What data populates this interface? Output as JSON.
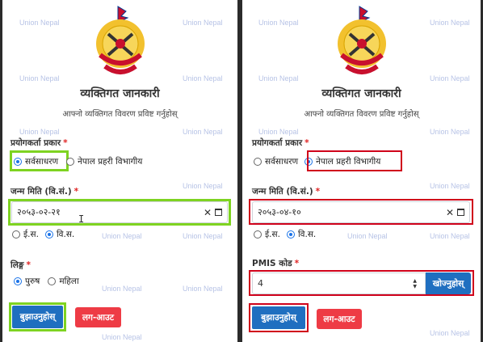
{
  "watermark": "Union Nepal",
  "left": {
    "title": "व्यक्तिगत जानकारी",
    "subtitle": "आफ्नो व्यक्तिगत विवरण प्रविष्ट गर्नुहोस्",
    "user_type_label": "प्रयोगकर्ता प्रकार",
    "user_type_options": [
      "सर्वसाधरण",
      "नेपाल प्रहरी विभागीय"
    ],
    "user_type_selected": "सर्वसाधरण",
    "dob_label": "जन्म मिति (वि.सं.)",
    "dob_value": "२०५३-०२-२१",
    "calendar_options": [
      "ई.स.",
      "वि.स."
    ],
    "calendar_selected": "वि.स.",
    "gender_label": "लिङ्ग",
    "gender_options": [
      "पुरुष",
      "महिला"
    ],
    "gender_selected": "पुरुष",
    "submit_label": "बुझाउनुहोस्",
    "logout_label": "लग-आउट"
  },
  "right": {
    "title": "व्यक्तिगत जानकारी",
    "subtitle": "आफ्नो व्यक्तिगत विवरण प्रविष्ट गर्नुहोस्",
    "user_type_label": "प्रयोगकर्ता प्रकार",
    "user_type_options": [
      "सर्वसाधरण",
      "नेपाल प्रहरी विभागीय"
    ],
    "user_type_selected": "नेपाल प्रहरी विभागीय",
    "dob_label": "जन्म मिति (वि.सं.)",
    "dob_value": "२०५३-०४-१०",
    "calendar_options": [
      "ई.स.",
      "वि.स."
    ],
    "calendar_selected": "वि.स.",
    "pmis_label": "PMIS कोड",
    "pmis_value": "4",
    "search_label": "खोज्नुहोस्",
    "submit_label": "बुझाउनुहोस्",
    "logout_label": "लग-आउट"
  },
  "colors": {
    "primary": "#1f6fc0",
    "danger": "#ee3b45",
    "highlight_green": "#7ed321",
    "highlight_red": "#d0021b",
    "required": "#e02424"
  }
}
